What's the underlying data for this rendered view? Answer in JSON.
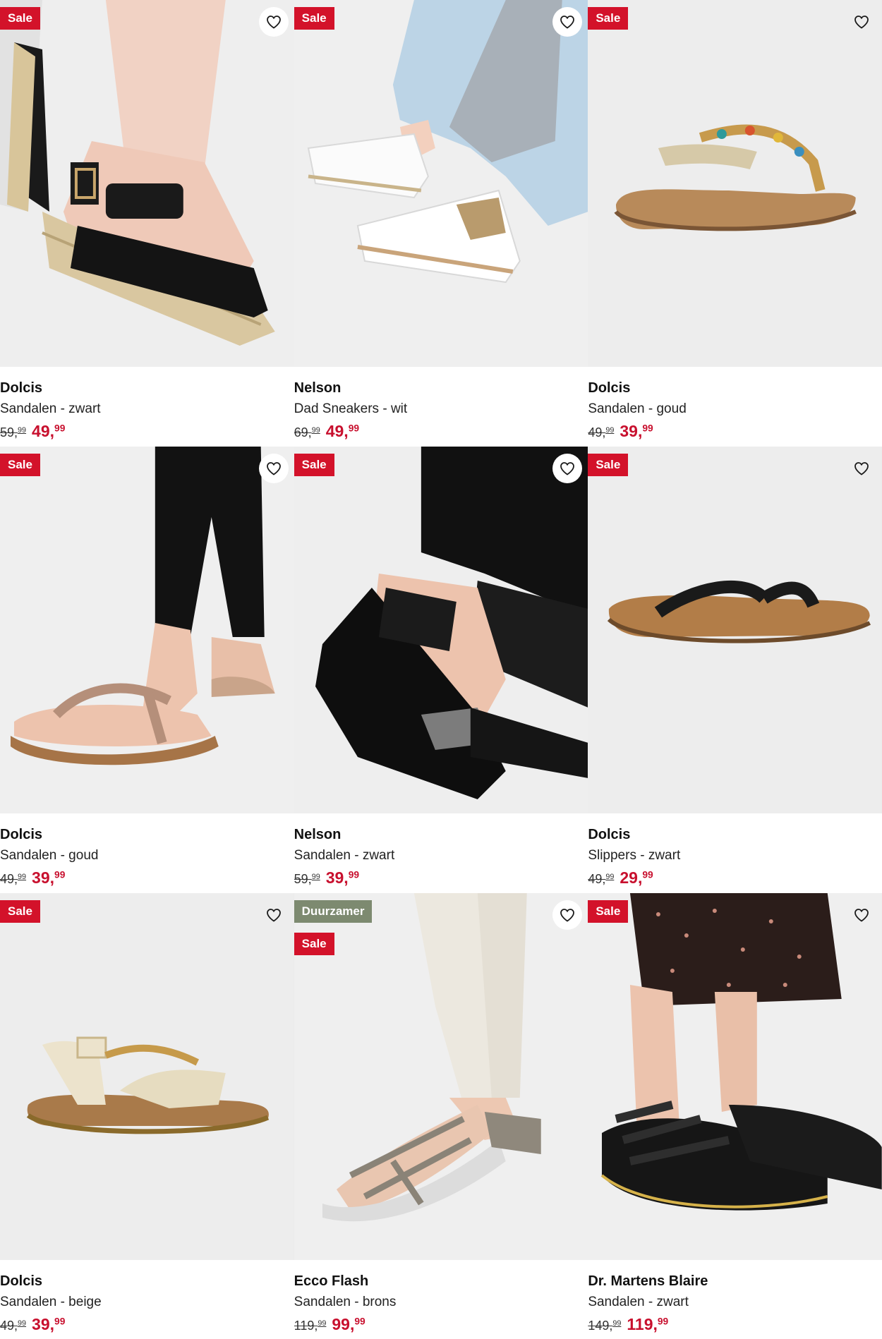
{
  "products": [
    {
      "brand": "Dolcis",
      "name": "Sandalen - zwart",
      "old_int": "59,",
      "old_dec": "99",
      "new_int": "49,",
      "new_dec": "99",
      "badges": [
        "Sale"
      ],
      "image": "black wedge espadrille sandal on foot"
    },
    {
      "brand": "Nelson",
      "name": "Dad Sneakers - wit",
      "old_int": "69,",
      "old_dec": "99",
      "new_int": "49,",
      "new_dec": "99",
      "badges": [
        "Sale"
      ],
      "image": "white dad sneakers worn with jeans"
    },
    {
      "brand": "Dolcis",
      "name": "Sandalen - goud",
      "old_int": "49,",
      "old_dec": "99",
      "new_int": "39,",
      "new_dec": "99",
      "badges": [
        "Sale"
      ],
      "image": "gold beaded toe-post sandal"
    },
    {
      "brand": "Dolcis",
      "name": "Sandalen - goud",
      "old_int": "49,",
      "old_dec": "99",
      "new_int": "39,",
      "new_dec": "99",
      "badges": [
        "Sale"
      ],
      "image": "gold glitter sandal on foot"
    },
    {
      "brand": "Nelson",
      "name": "Sandalen - zwart",
      "old_int": "59,",
      "old_dec": "99",
      "new_int": "39,",
      "new_dec": "99",
      "badges": [
        "Sale"
      ],
      "image": "black wedge sandal on foot"
    },
    {
      "brand": "Dolcis",
      "name": "Slippers - zwart",
      "old_int": "49,",
      "old_dec": "99",
      "new_int": "29,",
      "new_dec": "99",
      "badges": [
        "Sale"
      ],
      "image": "black braided flip flop"
    },
    {
      "brand": "Dolcis",
      "name": "Sandalen - beige",
      "old_int": "49,",
      "old_dec": "99",
      "new_int": "39,",
      "new_dec": "99",
      "badges": [
        "Sale"
      ],
      "image": "beige chain sandal"
    },
    {
      "brand": "Ecco Flash",
      "name": "Sandalen - brons",
      "old_int": "119,",
      "old_dec": "99",
      "new_int": "99,",
      "new_dec": "99",
      "badges": [
        "Duurzamer",
        "Sale"
      ],
      "image": "bronze sporty sandal on foot"
    },
    {
      "brand": "Dr. Martens Blaire",
      "name": "Sandalen - zwart",
      "old_int": "149,",
      "old_dec": "99",
      "new_int": "119,",
      "new_dec": "99",
      "badges": [
        "Sale"
      ],
      "image": "black chunky Dr. Martens sandal on foot"
    }
  ],
  "icons": {
    "favorite": "heart-outline-icon"
  },
  "colors": {
    "sale_badge": "#d3122a",
    "eco_badge": "#7d8a70",
    "price": "#c8102e"
  }
}
